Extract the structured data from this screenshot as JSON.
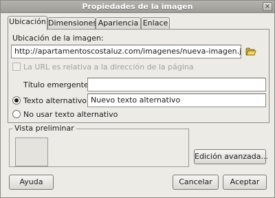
{
  "window": {
    "title": "Propiedades de la imagen",
    "close_glyph": "×"
  },
  "tabs": [
    {
      "label": "Ubicación",
      "active": true
    },
    {
      "label": "Dimensiones",
      "active": false
    },
    {
      "label": "Apariencia",
      "active": false
    },
    {
      "label": "Enlace",
      "active": false
    }
  ],
  "location": {
    "label": "Ubicación de la imagen:",
    "url": "http://apartamentoscostaluz.com/imagenes/nueva-imagen.jpg",
    "browse_icon": "folder-open-icon",
    "relative_checkbox_label": "La URL es relativa a la dirección de la página",
    "relative_checked": false,
    "relative_enabled": false,
    "tooltip_label": "Título emergente:",
    "tooltip_value": "",
    "alt_label": "Texto alternativo:",
    "alt_value": "Nuevo texto alternativo",
    "alt_selected": true,
    "no_alt_label": "No usar texto alternativo",
    "no_alt_selected": false
  },
  "preview": {
    "title": "Vista preliminar"
  },
  "buttons": {
    "advanced": "Edición avanzada...",
    "help": "Ayuda",
    "cancel": "Cancelar",
    "accept": "Aceptar"
  },
  "colors": {
    "folder_icon": "#d7b93a",
    "titlebar": "#a9a8a2"
  }
}
